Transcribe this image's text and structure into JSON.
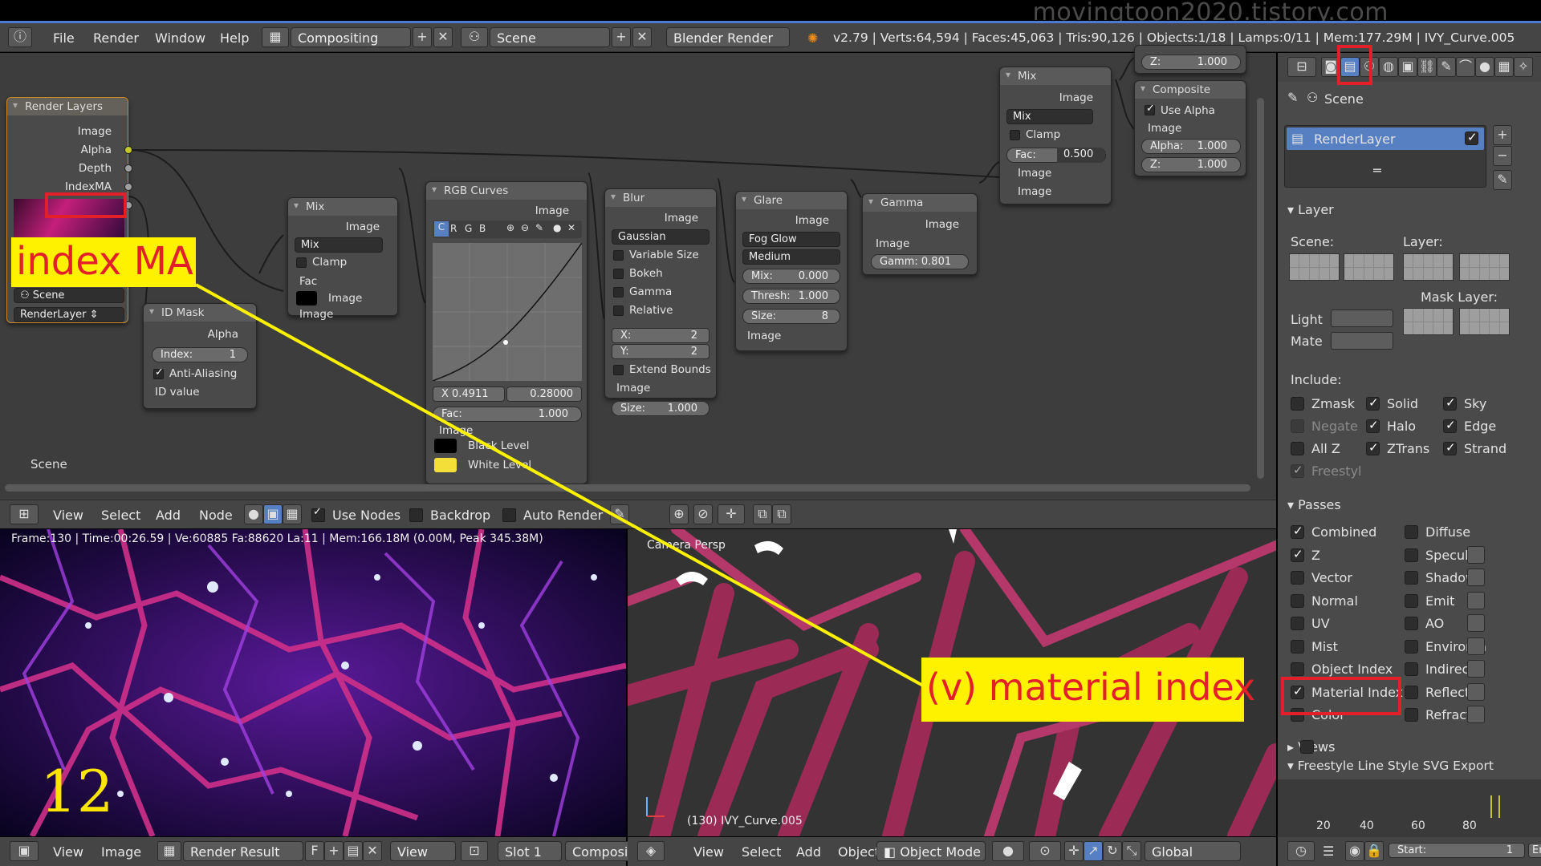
{
  "watermark": "movingtoon2020.tistory.com",
  "topbar": {
    "menus": [
      "File",
      "Render",
      "Window",
      "Help"
    ],
    "screen_layout": "Compositing",
    "scene": "Scene",
    "engine": "Blender Render",
    "stats": "v2.79 | Verts:64,594 | Faces:45,063 | Tris:90,126 | Objects:1/18 | Lamps:0/11 | Mem:177.29M | IVY_Curve.005"
  },
  "nodes": {
    "render_layers": {
      "title": "Render Layers",
      "outputs": [
        "Image",
        "Alpha",
        "Depth",
        "IndexMA"
      ],
      "scene": "Scene",
      "layer": "RenderLayer"
    },
    "id_mask": {
      "title": "ID Mask",
      "output": "Alpha",
      "index": "Index:",
      "index_value": "1",
      "anti_aliasing": "Anti-Aliasing",
      "input": "ID value"
    },
    "mix1": {
      "title": "Mix",
      "output": "Image",
      "mode": "Mix",
      "clamp": "Clamp",
      "fac": "Fac",
      "in1": "Image",
      "in2": "Image"
    },
    "rgb_curves": {
      "title": "RGB Curves",
      "output": "Image",
      "channels": [
        "C",
        "R",
        "G",
        "B"
      ],
      "x": "X 0.4911",
      "y": "0.28000",
      "fac": "Fac:",
      "fac_value": "1.000",
      "in_image": "Image",
      "black": "Black Level",
      "white": "White Level"
    },
    "blur": {
      "title": "Blur",
      "output": "Image",
      "type": "Gaussian",
      "variable_size": "Variable Size",
      "bokeh": "Bokeh",
      "gamma": "Gamma",
      "relative": "Relative",
      "x": "X:",
      "x_value": "2",
      "y": "Y:",
      "y_value": "2",
      "extend": "Extend Bounds",
      "in_image": "Image",
      "size": "Size:",
      "size_value": "1.000"
    },
    "glare": {
      "title": "Glare",
      "output": "Image",
      "type": "Fog Glow",
      "quality": "Medium",
      "mix": "Mix:",
      "mix_value": "0.000",
      "thresh": "Thresh:",
      "thresh_value": "1.000",
      "size": "Size:",
      "size_value": "8",
      "in_image": "Image"
    },
    "gamma": {
      "title": "Gamma",
      "output": "Image",
      "in_image": "Image",
      "gamma": "Gamm:",
      "gamma_value": "0.801"
    },
    "mix2": {
      "title": "Mix",
      "output": "Image",
      "mode": "Mix",
      "clamp": "Clamp",
      "fac": "Fac:",
      "fac_value": "0.500",
      "in1": "Image",
      "in2": "Image"
    },
    "composite": {
      "title": "Composite",
      "use_alpha": "Use Alpha",
      "in_image": "Image",
      "alpha": "Alpha:",
      "alpha_value": "1.000",
      "z": "Z:",
      "z_value": "1.000"
    },
    "viewer_partial": {
      "z": "Z:",
      "z_value": "1.000",
      "alpha": "Alpha:",
      "alpha_value": "1.000"
    }
  },
  "node_editor": {
    "scene_label": "Scene"
  },
  "node_toolbar": {
    "menus": [
      "View",
      "Select",
      "Add",
      "Node"
    ],
    "use_nodes": "Use Nodes",
    "backdrop": "Backdrop",
    "auto_render": "Auto Render"
  },
  "image_view": {
    "info": "Frame:130 | Time:00:26.59 | Ve:60885 Fa:88620 La:11 | Mem:166.18M (0.00M, Peak 345.38M)",
    "frame_number": "12"
  },
  "image_toolbar": {
    "menus": [
      "View",
      "Image"
    ],
    "image": "Render Result",
    "f": "F",
    "view": "View",
    "slot": "Slot 1",
    "pass": "Composite"
  },
  "viewport": {
    "label": "Camera Persp",
    "object": "(130) IVY_Curve.005"
  },
  "viewport_toolbar": {
    "menus": [
      "View",
      "Select",
      "Add",
      "Object"
    ],
    "mode": "Object Mode",
    "orientation": "Global"
  },
  "properties": {
    "scene": "Scene",
    "layer_item": "RenderLayer",
    "layer_panel": "Layer",
    "scene_label": "Scene:",
    "layer_label": "Layer:",
    "mask_layer": "Mask Layer:",
    "light": "Light",
    "mate": "Mate",
    "include": "Include:",
    "include_items": [
      {
        "label": "Zmask",
        "checked": false
      },
      {
        "label": "Solid",
        "checked": true
      },
      {
        "label": "Sky",
        "checked": true
      },
      {
        "label": "Negate",
        "checked": false
      },
      {
        "label": "Halo",
        "checked": true
      },
      {
        "label": "Edge",
        "checked": true
      },
      {
        "label": "All Z",
        "checked": false
      },
      {
        "label": "ZTrans",
        "checked": true
      },
      {
        "label": "Strand",
        "checked": true
      },
      {
        "label": "Freestyl",
        "checked": true
      }
    ],
    "passes_panel": "Passes",
    "passes_left": [
      {
        "label": "Combined",
        "checked": true
      },
      {
        "label": "Z",
        "checked": true
      },
      {
        "label": "Vector",
        "checked": false
      },
      {
        "label": "Normal",
        "checked": false
      },
      {
        "label": "UV",
        "checked": false
      },
      {
        "label": "Mist",
        "checked": false
      },
      {
        "label": "Object Index",
        "checked": false
      },
      {
        "label": "Material Index",
        "checked": true
      },
      {
        "label": "Color",
        "checked": false
      }
    ],
    "passes_right": [
      {
        "label": "Diffuse",
        "checked": false
      },
      {
        "label": "Specular",
        "checked": false
      },
      {
        "label": "Shadow",
        "checked": false
      },
      {
        "label": "Emit",
        "checked": false
      },
      {
        "label": "AO",
        "checked": false
      },
      {
        "label": "Environm",
        "checked": false
      },
      {
        "label": "Indirect",
        "checked": false
      },
      {
        "label": "Reflectio",
        "checked": false
      },
      {
        "label": "Refractio",
        "checked": false
      }
    ],
    "views_panel": "Views",
    "freestyle_panel": "Freestyle Line Style SVG Export"
  },
  "timeline": {
    "ticks": [
      "20",
      "40",
      "60",
      "80"
    ],
    "start_label": "Start:",
    "start_value": "1",
    "end_label": "En"
  },
  "annotations": {
    "label1": "index MA",
    "label2": "(v) material index"
  },
  "colors": {
    "annotation_yellow": "#fff200",
    "annotation_red": "#e3202a",
    "socket_yellow": "#c7c729",
    "selection_blue": "#5680c2"
  }
}
